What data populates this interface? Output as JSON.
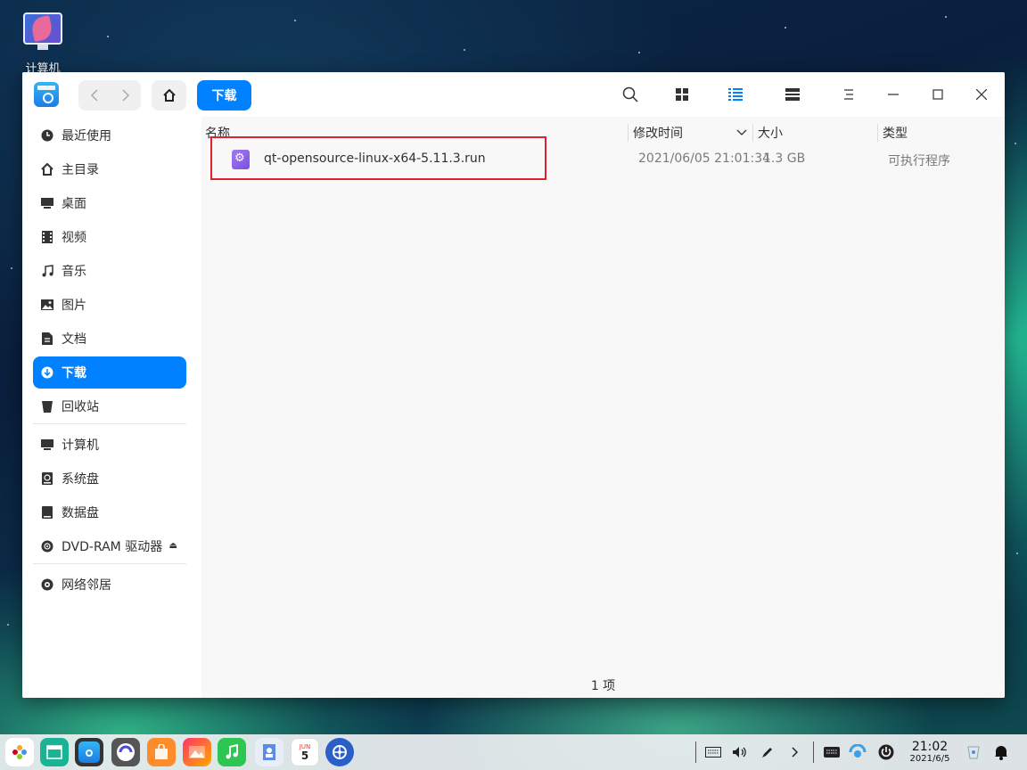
{
  "desktop": {
    "icon_label": "计算机"
  },
  "window": {
    "breadcrumb": "下载",
    "sidebar": {
      "items": [
        {
          "label": "最近使用",
          "icon": "clock-icon"
        },
        {
          "label": "主目录",
          "icon": "home-icon"
        },
        {
          "label": "桌面",
          "icon": "desktop-icon"
        },
        {
          "label": "视频",
          "icon": "video-icon"
        },
        {
          "label": "音乐",
          "icon": "music-icon"
        },
        {
          "label": "图片",
          "icon": "picture-icon"
        },
        {
          "label": "文档",
          "icon": "document-icon"
        },
        {
          "label": "下载",
          "icon": "download-icon",
          "active": true
        },
        {
          "label": "回收站",
          "icon": "trash-icon"
        }
      ],
      "devices": [
        {
          "label": "计算机",
          "icon": "computer-icon"
        },
        {
          "label": "系统盘",
          "icon": "disk-icon"
        },
        {
          "label": "数据盘",
          "icon": "drive-icon"
        },
        {
          "label": "DVD-RAM 驱动器",
          "icon": "dvd-icon"
        }
      ],
      "network": {
        "label": "网络邻居",
        "icon": "network-icon"
      }
    },
    "columns": {
      "name": "名称",
      "modified": "修改时间",
      "size": "大小",
      "type": "类型"
    },
    "files": [
      {
        "name": "qt-opensource-linux-x64-5.11.3.run",
        "modified": "2021/06/05 21:01:34",
        "size": "1.3 GB",
        "type": "可执行程序"
      }
    ],
    "status": "1 项"
  },
  "taskbar": {
    "time": "21:02",
    "date": "2021/6/5",
    "calendar_month": "JUN",
    "calendar_day": "5"
  }
}
